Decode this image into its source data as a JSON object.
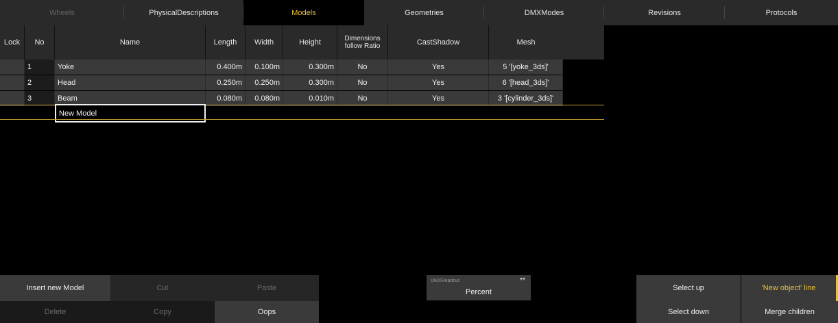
{
  "tabs": [
    {
      "label": "Wheels",
      "state": "disabled"
    },
    {
      "label": "PhysicalDescriptions",
      "state": "normal"
    },
    {
      "label": "Models",
      "state": "active"
    },
    {
      "label": "Geometries",
      "state": "normal"
    },
    {
      "label": "DMXModes",
      "state": "normal"
    },
    {
      "label": "Revisions",
      "state": "normal"
    },
    {
      "label": "Protocols",
      "state": "normal"
    }
  ],
  "table": {
    "headers": {
      "lock": "Lock",
      "no": "No",
      "name": "Name",
      "length": "Length",
      "width": "Width",
      "height": "Height",
      "dimensions_line1": "Dimensions",
      "dimensions_line2": "follow Ratio",
      "castshadow": "CastShadow",
      "mesh": "Mesh"
    },
    "rows": [
      {
        "no": "1",
        "name": "Yoke",
        "length": "0.400m",
        "width": "0.100m",
        "height": "0.300m",
        "dimensions": "No",
        "castshadow": "Yes",
        "mesh": "5 '[yoke_3ds]'"
      },
      {
        "no": "2",
        "name": "Head",
        "length": "0.250m",
        "width": "0.250m",
        "height": "0.300m",
        "dimensions": "No",
        "castshadow": "Yes",
        "mesh": "6 '[head_3ds]'"
      },
      {
        "no": "3",
        "name": "Beam",
        "length": "0.080m",
        "width": "0.080m",
        "height": "0.010m",
        "dimensions": "No",
        "castshadow": "Yes",
        "mesh": "3 '[cylinder_3ds]'"
      }
    ],
    "new_row_name": "New Model"
  },
  "buttons": {
    "insert_new": "Insert new Model",
    "cut": "Cut",
    "paste": "Paste",
    "delete": "Delete",
    "copy": "Copy",
    "oops": "Oops",
    "select_up": "Select up",
    "select_down": "Select down",
    "new_object_line": "'New object' line",
    "merge_children": "Merge children"
  },
  "readout": {
    "label": "DMXReadout",
    "value": "Percent"
  },
  "colors": {
    "accent": "#e8c23a",
    "separator": "#c9a035"
  }
}
